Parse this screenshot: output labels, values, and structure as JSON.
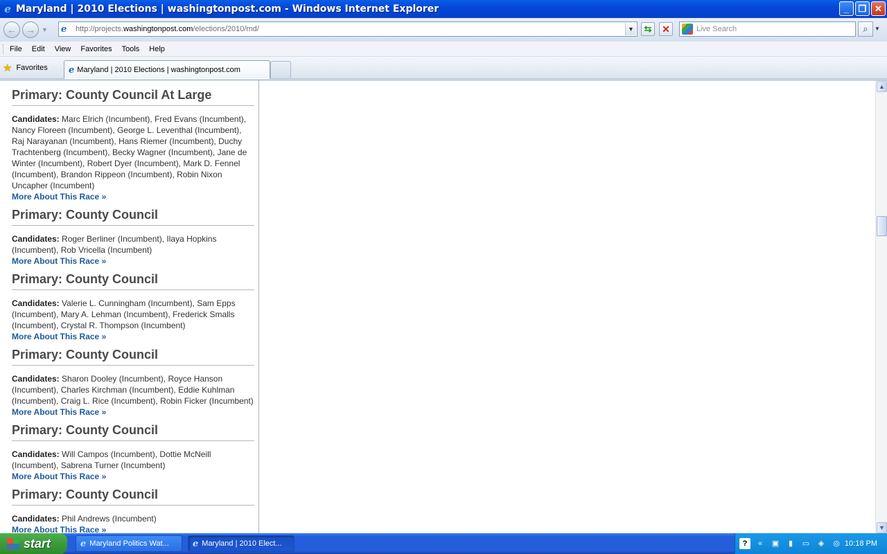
{
  "window": {
    "title": "Maryland | 2010 Elections | washingtonpost.com - Windows Internet Explorer",
    "minimize_glyph": "_",
    "restore_glyph": "❐",
    "close_glyph": "✕"
  },
  "address": {
    "url_prefix": "http://projects.",
    "url_domain": "washingtonpost.com",
    "url_path": "/elections/2010/md/",
    "search_placeholder": "Live Search"
  },
  "menu": [
    "File",
    "Edit",
    "View",
    "Favorites",
    "Tools",
    "Help"
  ],
  "tabs": {
    "favorites_label": "Favorites",
    "active_tab_label": "Maryland | 2010 Elections | washingtonpost.com"
  },
  "races": [
    {
      "title": "Primary: County Council At Large",
      "candidates_label": "Candidates:",
      "candidates": "Marc Elrich (Incumbent), Fred Evans (Incumbent), Nancy Floreen (Incumbent), George L. Leventhal (Incumbent), Raj Narayanan (Incumbent), Hans Riemer (Incumbent), Duchy Trachtenberg (Incumbent), Becky Wagner (Incumbent), Jane de Winter (Incumbent), Robert Dyer (Incumbent), Mark D. Fennel (Incumbent), Brandon Rippeon (Incumbent), Robin Nixon Uncapher (Incumbent)",
      "link": "More About This Race »"
    },
    {
      "title": "Primary: County Council",
      "candidates_label": "Candidates:",
      "candidates": "Roger Berliner (Incumbent), Ilaya Hopkins (Incumbent), Rob Vricella (Incumbent)",
      "link": "More About This Race »"
    },
    {
      "title": "Primary: County Council",
      "candidates_label": "Candidates:",
      "candidates": "Valerie L. Cunningham (Incumbent), Sam Epps (Incumbent), Mary A. Lehman (Incumbent), Frederick Smalls (Incumbent), Crystal R. Thompson (Incumbent)",
      "link": "More About This Race »"
    },
    {
      "title": "Primary: County Council",
      "candidates_label": "Candidates:",
      "candidates": "Sharon Dooley (Incumbent), Royce Hanson (Incumbent), Charles Kirchman (Incumbent), Eddie Kuhlman (Incumbent), Craig L. Rice (Incumbent), Robin Ficker (Incumbent)",
      "link": "More About This Race »"
    },
    {
      "title": "Primary: County Council",
      "candidates_label": "Candidates:",
      "candidates": "Will Campos (Incumbent), Dottie McNeill (Incumbent), Sabrena Turner (Incumbent)",
      "link": "More About This Race »"
    },
    {
      "title": "Primary: County Council",
      "candidates_label": "Candidates:",
      "candidates": "Phil Andrews (Incumbent)",
      "link": "More About This Race »"
    }
  ],
  "taskbar": {
    "start_label": "start",
    "items": [
      "Maryland Politics Wat...",
      "Maryland | 2010 Elect..."
    ],
    "clock": "10:18 PM"
  },
  "colors": {
    "titlebar": "#0547d8",
    "link": "#1f5a9b",
    "heading": "#4a4a4a",
    "taskbar": "#245edb",
    "start": "#3c9a3c"
  }
}
